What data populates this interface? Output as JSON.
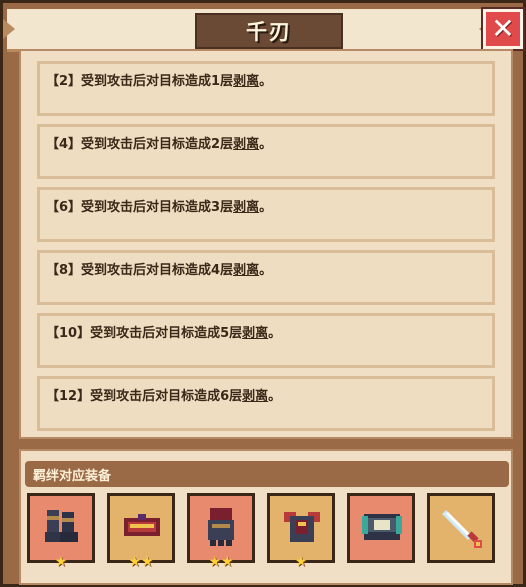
{
  "title": "千刃",
  "close_icon": "close-icon",
  "entries": [
    {
      "level": "【2】",
      "text": "受到攻击后对目标造成1层",
      "keyword": "剥离",
      "end": "。"
    },
    {
      "level": "【4】",
      "text": "受到攻击后对目标造成2层",
      "keyword": "剥离",
      "end": "。"
    },
    {
      "level": "【6】",
      "text": "受到攻击后对目标造成3层",
      "keyword": "剥离",
      "end": "。"
    },
    {
      "level": "【8】",
      "text": "受到攻击后对目标造成4层",
      "keyword": "剥离",
      "end": "。"
    },
    {
      "level": "【10】",
      "text": "受到攻击后对目标造成5层",
      "keyword": "剥离",
      "end": "。"
    },
    {
      "level": "【12】",
      "text": "受到攻击后对目标造成6层",
      "keyword": "剥离",
      "end": "。"
    }
  ],
  "equipment_section": {
    "label": "羁绊对应装备",
    "slots": [
      {
        "icon": "boots-icon",
        "rarity_color": "#e78a6e",
        "stars": "★"
      },
      {
        "icon": "crown-icon",
        "rarity_color": "#e3b26b",
        "stars": "★★"
      },
      {
        "icon": "gauntlet-icon",
        "rarity_color": "#e78a6e",
        "stars": "★★"
      },
      {
        "icon": "armor-icon",
        "rarity_color": "#e3b26b",
        "stars": "★"
      },
      {
        "icon": "helmet-icon",
        "rarity_color": "#e78a6e",
        "stars": ""
      },
      {
        "icon": "sword-icon",
        "rarity_color": "#e3b26b",
        "stars": ""
      }
    ]
  }
}
